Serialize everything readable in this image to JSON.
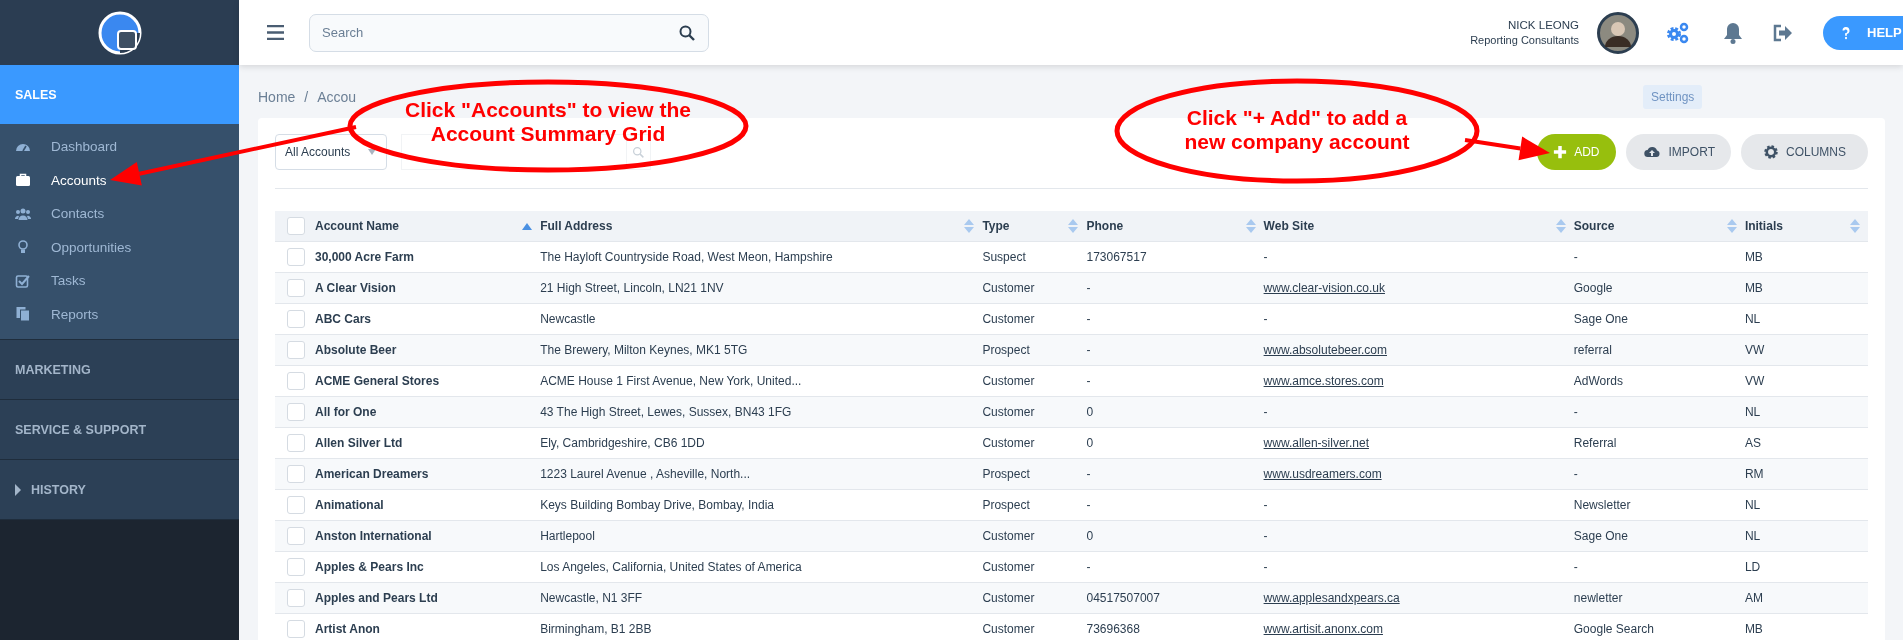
{
  "sidebar": {
    "sections": [
      {
        "label": "SALES",
        "kind": "plain",
        "selected": true,
        "items": [
          {
            "label": "Dashboard",
            "selected": false
          },
          {
            "label": "Accounts",
            "selected": true
          },
          {
            "label": "Contacts",
            "selected": false
          },
          {
            "label": "Opportunities",
            "selected": false
          },
          {
            "label": "Tasks",
            "selected": false
          },
          {
            "label": "Reports",
            "selected": false
          }
        ]
      },
      {
        "label": "MARKETING",
        "kind": "plain",
        "selected": false
      },
      {
        "label": "SERVICE & SUPPORT",
        "kind": "plain",
        "selected": false
      },
      {
        "label": "HISTORY",
        "kind": "collapsible",
        "expanded": false,
        "selected": false
      }
    ]
  },
  "topbar": {
    "search": {
      "placeholder": "Search"
    },
    "user": {
      "name": "NICK LEONG",
      "company": "Reporting Consultants"
    },
    "tooltip": "Settings",
    "help": "HELP"
  },
  "breadcrumb": {
    "items": [
      "Home",
      "Accou"
    ],
    "separator": "/"
  },
  "toolbar": {
    "filter": "All Accounts",
    "buttons": [
      {
        "label": "ADD",
        "kind": "add"
      },
      {
        "label": "IMPORT",
        "kind": "import"
      },
      {
        "label": "COLUMNS",
        "kind": "columns"
      }
    ]
  },
  "table": {
    "all_checked": false,
    "columns": [
      {
        "label": "Account Name",
        "sorted": true
      },
      {
        "label": "Full Address",
        "sorted": false
      },
      {
        "label": "Type",
        "sorted": false
      },
      {
        "label": "Phone",
        "sorted": false
      },
      {
        "label": "Web Site",
        "sorted": false
      },
      {
        "label": "Source",
        "sorted": false
      },
      {
        "label": "Initials",
        "sorted": false
      }
    ],
    "rows": [
      {
        "checked": false,
        "name": "30,000 Acre Farm",
        "address": "The Hayloft Countryside Road, West Meon, Hampshire",
        "type": "Suspect",
        "phone": "173067517",
        "website": "-",
        "website_link": false,
        "source": "-",
        "initials": "MB"
      },
      {
        "checked": false,
        "name": "A Clear Vision",
        "address": "21 High Street, Lincoln, LN21 1NV",
        "type": "Customer",
        "phone": "-",
        "website": "www.clear-vision.co.uk",
        "website_link": true,
        "source": "Google",
        "initials": "MB"
      },
      {
        "checked": false,
        "name": "ABC Cars",
        "address": "Newcastle",
        "type": "Customer",
        "phone": "-",
        "website": "-",
        "website_link": false,
        "source": "Sage One",
        "initials": "NL"
      },
      {
        "checked": false,
        "name": "Absolute Beer",
        "address": "The Brewery, Milton Keynes, MK1 5TG",
        "type": "Prospect",
        "phone": "-",
        "website": "www.absolutebeer.com",
        "website_link": true,
        "source": "referral",
        "initials": "VW"
      },
      {
        "checked": false,
        "name": "ACME General Stores",
        "address": "ACME House 1 First Avenue, New York, United...",
        "type": "Customer",
        "phone": "-",
        "website": "www.amce.stores.com",
        "website_link": true,
        "source": "AdWords",
        "initials": "VW"
      },
      {
        "checked": false,
        "name": "All for One",
        "address": "43 The High Street, Lewes, Sussex, BN43 1FG",
        "type": "Customer",
        "phone": "0",
        "website": "-",
        "website_link": false,
        "source": "-",
        "initials": "NL"
      },
      {
        "checked": false,
        "name": "Allen Silver Ltd",
        "address": "Ely, Cambridgeshire, CB6 1DD",
        "type": "Customer",
        "phone": "0",
        "website": "www.allen-silver.net",
        "website_link": true,
        "source": "Referral",
        "initials": "AS"
      },
      {
        "checked": false,
        "name": "American Dreamers",
        "address": "1223 Laurel Avenue , Asheville, North...",
        "type": "Prospect",
        "phone": "-",
        "website": "www.usdreamers.com",
        "website_link": true,
        "source": "-",
        "initials": "RM"
      },
      {
        "checked": false,
        "name": "Animational",
        "address": "Keys Building Bombay Drive, Bombay, India",
        "type": "Prospect",
        "phone": "-",
        "website": "-",
        "website_link": false,
        "source": "Newsletter",
        "initials": "NL"
      },
      {
        "checked": false,
        "name": "Anston International",
        "address": "Hartlepool",
        "type": "Customer",
        "phone": "0",
        "website": "-",
        "website_link": false,
        "source": "Sage One",
        "initials": "NL"
      },
      {
        "checked": false,
        "name": "Apples & Pears Inc",
        "address": "Los Angeles, California, United States of America",
        "type": "Customer",
        "phone": "-",
        "website": "-",
        "website_link": false,
        "source": "-",
        "initials": "LD"
      },
      {
        "checked": false,
        "name": "Apples and Pears Ltd",
        "address": "Newcastle, N1 3FF",
        "type": "Customer",
        "phone": "04517507007",
        "website": "www.applesandxpears.ca",
        "website_link": true,
        "source": "newletter",
        "initials": "AM"
      },
      {
        "checked": false,
        "name": "Artist Anon",
        "address": "Birmingham, B1 2BB",
        "type": "Customer",
        "phone": "73696368",
        "website": "www.artisit.anonx.com",
        "website_link": true,
        "source": "Google Search",
        "initials": "MB"
      }
    ]
  },
  "annotations": [
    {
      "lines": [
        "Click \"Accounts\" to view the",
        "Account Summary Grid"
      ]
    },
    {
      "lines": [
        "Click \"+ Add\" to add a",
        "new company account"
      ]
    }
  ]
}
